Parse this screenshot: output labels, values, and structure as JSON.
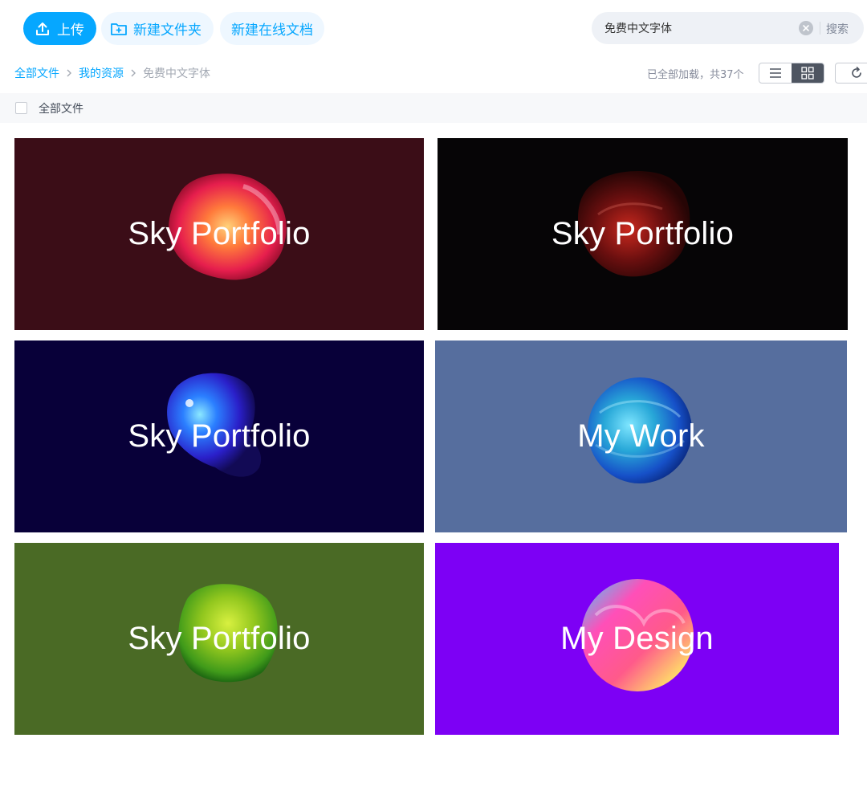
{
  "toolbar": {
    "upload_label": "上传",
    "new_folder_label": "新建文件夹",
    "new_doc_label": "新建在线文档"
  },
  "search": {
    "value": "免费中文字体",
    "button_label": "搜索"
  },
  "breadcrumb": {
    "items": [
      "全部文件",
      "我的资源"
    ],
    "current": "免费中文字体"
  },
  "status": {
    "load_text": "已全部加载，共37个"
  },
  "list_header": {
    "label": "全部文件"
  },
  "files": [
    {
      "title": "Sky Portfolio",
      "bg": "#3b0d17",
      "blob": "orange-red"
    },
    {
      "title": "Sky Portfolio",
      "bg": "#060506",
      "blob": "dark-red"
    },
    {
      "title": "Sky Portfolio",
      "bg": "#080039",
      "blob": "blue-purple"
    },
    {
      "title": "My Work",
      "bg": "#566e9e",
      "blob": "teal-blue"
    },
    {
      "title": "Sky Portfolio",
      "bg": "#4a6a25",
      "blob": "lime-green"
    },
    {
      "title": "My Design",
      "bg": "#7d00f5",
      "blob": "rainbow"
    }
  ],
  "colors": {
    "accent": "#06a7ff",
    "accent_light": "#eef7ff"
  }
}
